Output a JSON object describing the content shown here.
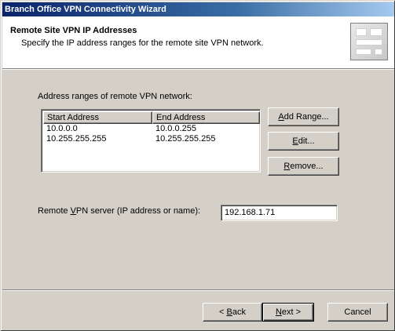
{
  "window": {
    "title": "Branch Office VPN Connectivity Wizard"
  },
  "header": {
    "title": "Remote Site VPN IP Addresses",
    "subtitle": "Specify the IP address ranges for the remote site VPN network.",
    "graphic_icon": "wizard-graphic-icon"
  },
  "ranges": {
    "label": "Address ranges of remote VPN network:",
    "columns": [
      "Start Address",
      "End Address"
    ],
    "rows": [
      {
        "start": "10.0.0.0",
        "end": "10.0.0.255"
      },
      {
        "start": "10.255.255.255",
        "end": "10.255.255.255"
      }
    ],
    "add_button": {
      "pre": "",
      "key": "A",
      "post": "dd Range..."
    },
    "edit_button": {
      "pre": "",
      "key": "E",
      "post": "dit..."
    },
    "remove_button": {
      "pre": "",
      "key": "R",
      "post": "emove..."
    }
  },
  "server": {
    "label_pre": "Remote ",
    "label_key": "V",
    "label_post": "PN server (IP address or name):",
    "value": "192.168.1.71"
  },
  "footer": {
    "back_button": {
      "pre": "< ",
      "key": "B",
      "post": "ack"
    },
    "next_button": {
      "pre": "",
      "key": "N",
      "post": "ext >"
    },
    "cancel_label": "Cancel"
  }
}
